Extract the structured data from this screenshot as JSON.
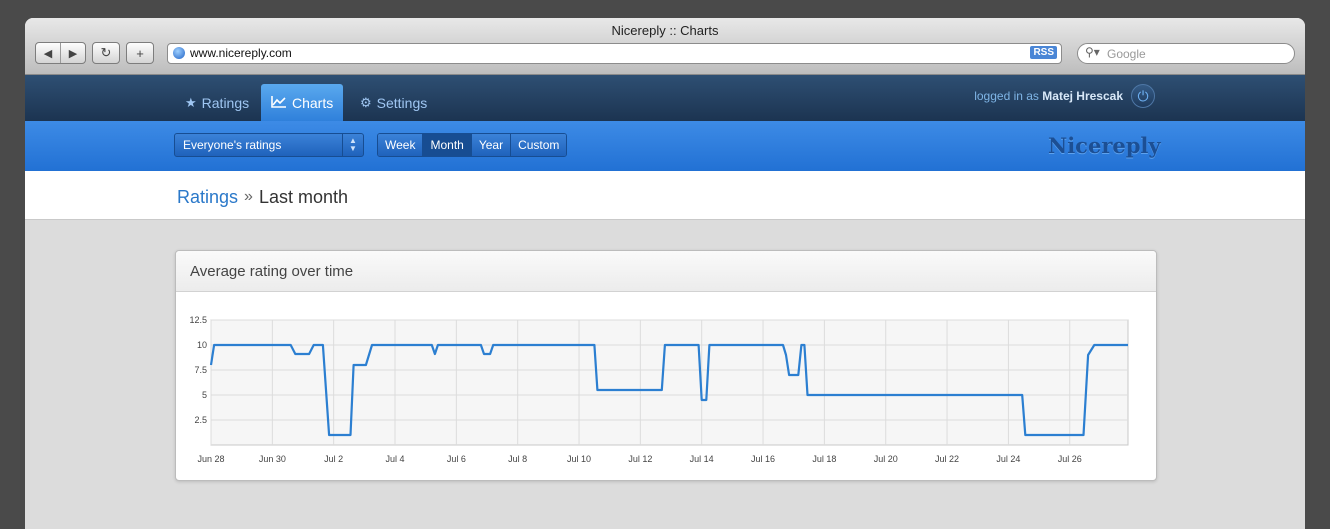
{
  "browser": {
    "window_title": "Nicereply :: Charts",
    "url": "www.nicereply.com",
    "rss_label": "RSS",
    "search_placeholder": "Google"
  },
  "app": {
    "tabs": [
      {
        "icon": "star-icon",
        "label": "Ratings"
      },
      {
        "icon": "chart-icon",
        "label": "Charts"
      },
      {
        "icon": "gear-icon",
        "label": "Settings"
      }
    ],
    "active_tab": "Charts",
    "logged_in_prefix": "logged in as",
    "user_name": "Matej Hrescak",
    "filter_selected": "Everyone's ratings",
    "periods": [
      "Week",
      "Month",
      "Year",
      "Custom"
    ],
    "active_period": "Month",
    "brand": "Nicereply",
    "colors": {
      "accent": "#2a78c9",
      "line": "#2c7fd1",
      "nav_dark": "#1c3451",
      "nav_blue": "#2f80db"
    }
  },
  "breadcrumb": {
    "link": "Ratings",
    "separator": "»",
    "current": "Last month"
  },
  "panel": {
    "title": "Average rating over time"
  },
  "chart_data": {
    "type": "line",
    "title": "Average rating over time",
    "xlabel": "",
    "ylabel": "",
    "grid": true,
    "legend": "none",
    "ylim": [
      0,
      12.5
    ],
    "xlim": [
      0,
      29.9
    ],
    "yticks": [
      "2.5",
      "5",
      "7.5",
      "10",
      "12.5"
    ],
    "xticks": [
      "Jun 28",
      "Jun 30",
      "Jul 2",
      "Jul 4",
      "Jul 6",
      "Jul 8",
      "Jul 10",
      "Jul 12",
      "Jul 14",
      "Jul 16",
      "Jul 18",
      "Jul 20",
      "Jul 22",
      "Jul 24",
      "Jul 26"
    ],
    "x_unit": "days since Jun 28",
    "series": [
      {
        "color": "#2c7fd1",
        "points": [
          [
            0,
            8
          ],
          [
            0.1,
            10
          ],
          [
            2.6,
            10
          ],
          [
            2.75,
            9.1
          ],
          [
            3.2,
            9.1
          ],
          [
            3.35,
            10
          ],
          [
            3.65,
            10
          ],
          [
            3.85,
            1
          ],
          [
            4.55,
            1
          ],
          [
            4.65,
            8
          ],
          [
            5.05,
            8
          ],
          [
            5.25,
            10
          ],
          [
            7.2,
            10
          ],
          [
            7.3,
            9.1
          ],
          [
            7.4,
            10
          ],
          [
            8.8,
            10
          ],
          [
            8.9,
            9.1
          ],
          [
            9.1,
            9.1
          ],
          [
            9.2,
            10
          ],
          [
            12.5,
            10
          ],
          [
            12.6,
            5.5
          ],
          [
            14.7,
            5.5
          ],
          [
            14.8,
            10
          ],
          [
            15.9,
            10
          ],
          [
            16.0,
            4.5
          ],
          [
            16.15,
            4.5
          ],
          [
            16.25,
            10
          ],
          [
            18.65,
            10
          ],
          [
            18.75,
            9
          ],
          [
            18.85,
            7
          ],
          [
            19.15,
            7
          ],
          [
            19.25,
            10
          ],
          [
            19.35,
            10
          ],
          [
            19.45,
            5
          ],
          [
            26.45,
            5
          ],
          [
            26.55,
            1
          ],
          [
            28.45,
            1
          ],
          [
            28.6,
            9
          ],
          [
            28.8,
            10
          ],
          [
            29.9,
            10
          ]
        ]
      }
    ]
  }
}
